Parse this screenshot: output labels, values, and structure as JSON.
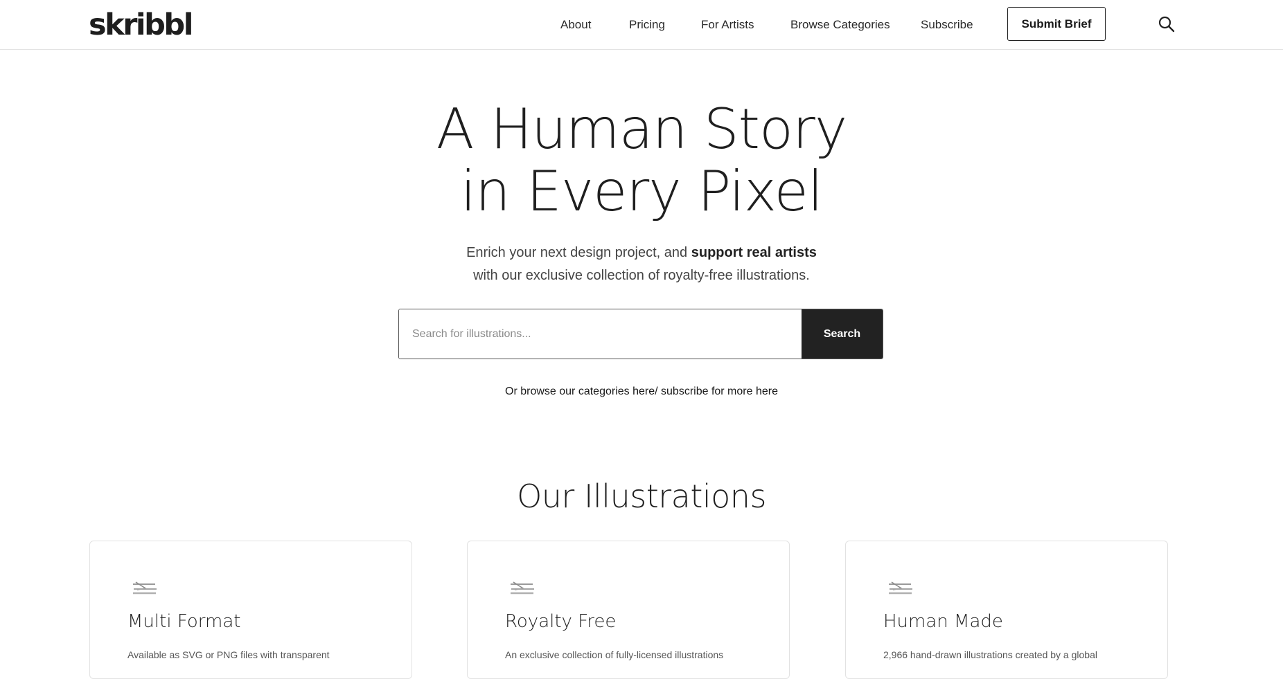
{
  "header": {
    "logo": "skribbl",
    "nav": [
      "About",
      "Pricing",
      "For Artists",
      "Browse Categories",
      "Subscribe"
    ],
    "submit_brief": "Submit Brief",
    "search_icon": "search-icon"
  },
  "hero": {
    "title_line1": "A Human Story",
    "title_line2": "in Every Pixel",
    "sub_line1_a": "Enrich your next design project, and ",
    "sub_line1_b": "support real artists",
    "sub_line2": "with our exclusive collection of royalty-free illustrations.",
    "search_placeholder": "Search for illustrations...",
    "search_button": "Search",
    "browse_prefix": "Or browse our categories ",
    "browse_link1": "here",
    "browse_middle": "/ subscribe for more ",
    "browse_link2": "here"
  },
  "illustrations": {
    "title": "Our Illustrations",
    "cards": [
      {
        "title": "Multi Format",
        "text": "Available as SVG or PNG files with transparent",
        "icon": "sketch-icon"
      },
      {
        "title": "Royalty Free",
        "text": "An exclusive collection of fully-licensed illustrations",
        "icon": "sketch-icon"
      },
      {
        "title": "Human Made",
        "text": "2,966 hand-drawn illustrations created by a global",
        "icon": "sketch-icon"
      }
    ]
  }
}
